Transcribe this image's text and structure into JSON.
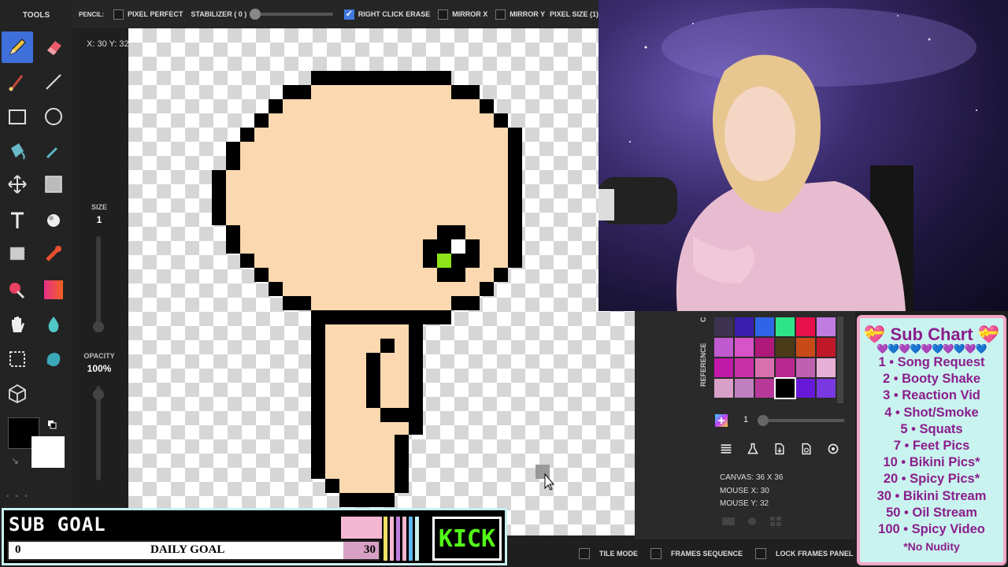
{
  "tools_panel": {
    "title": "TOOLS",
    "size_label": "SIZE",
    "size_value": "1",
    "opacity_label": "OPACITY",
    "opacity_value": "100%"
  },
  "cursor_coords": "X: 30 Y: 32",
  "topbar": {
    "tool_name": "PENCIL:",
    "pixel_perfect": "PIXEL PERFECT",
    "stabilizer": "STABILIZER ( 0 )",
    "right_click_erase": "RIGHT CLICK ERASE",
    "mirror_x": "MIRROR X",
    "mirror_y": "MIRROR Y",
    "pixel_size": "PIXEL SIZE (1)"
  },
  "right_panel": {
    "tab_reference": "REFERENCE",
    "tab_other": "C",
    "layer_number": "1",
    "canvas_size": "CANVAS: 36 X 36",
    "mouse_x": "MOUSE X: 30",
    "mouse_y": "MOUSE Y: 32",
    "palette": [
      "#3d3350",
      "#3a1fae",
      "#2f64e8",
      "#2ee488",
      "#e8104a",
      "#c07ce0",
      "#c05ad0",
      "#d852c8",
      "#b0187a",
      "#4a3a18",
      "#c84a18",
      "#c01828",
      "#c018a8",
      "#c830a8",
      "#d870b0",
      "#b82890",
      "#c060b0",
      "#e8b0d8",
      "#d8a0c8",
      "#c080c0",
      "#b83898",
      "#000000",
      "#6818d8",
      "#7a38e0"
    ],
    "selected_swatch": 21
  },
  "bottombar": {
    "tile_mode": "TILE MODE",
    "frames_sequence": "FRAMES SEQUENCE",
    "lock_frames_panel": "LOCK FRAMES PANEL"
  },
  "sub_goal": {
    "title": "SUB GOAL",
    "current": "0",
    "label": "DAILY GOAL",
    "target": "30",
    "platform": "KICK"
  },
  "sub_chart": {
    "title": "Sub Chart",
    "items": [
      "1 • Song Request",
      "2 • Booty Shake",
      "3 • Reaction Vid",
      "4 • Shot/Smoke",
      "5 • Squats",
      "7 • Feet Pics",
      "10 • Bikini Pics*",
      "20 • Spicy Pics*",
      "30 • Bikini Stream",
      "50 • Oil Stream",
      "100 • Spicy Video"
    ],
    "footer": "*No Nudity"
  }
}
